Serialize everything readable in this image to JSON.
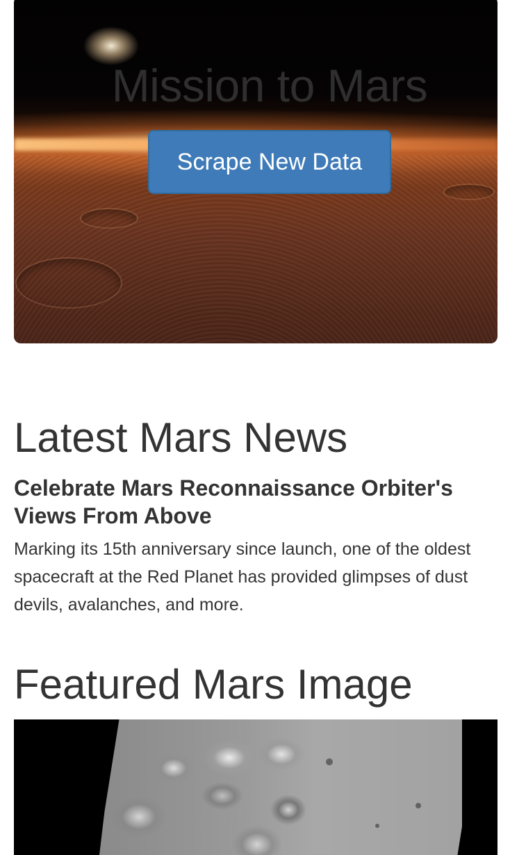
{
  "hero": {
    "title": "Mission to Mars",
    "button_label": "Scrape New Data"
  },
  "news": {
    "section_title": "Latest Mars News",
    "headline": "Celebrate Mars Reconnaissance Orbiter's Views From Above",
    "teaser": "Marking its 15th anniversary since launch, one of the oldest spacecraft at the Red Planet has provided glimpses of dust devils, avalanches, and more."
  },
  "featured_image": {
    "section_title": "Featured Mars Image"
  },
  "colors": {
    "button_primary": "#3f7bb8",
    "text": "#333333"
  }
}
